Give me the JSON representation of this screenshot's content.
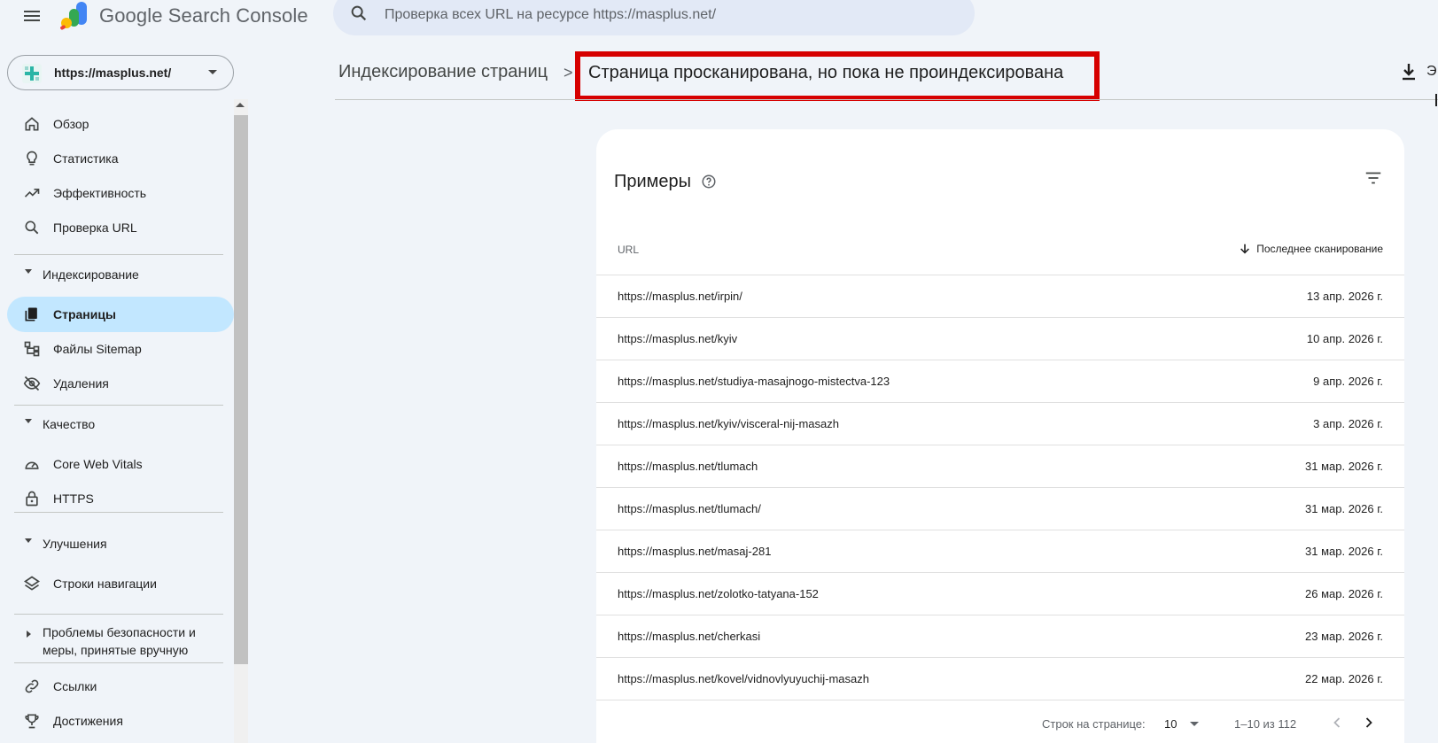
{
  "app": {
    "brand": "Google Search Console",
    "search_placeholder": "Проверка всех URL на ресурсе https://masplus.net/"
  },
  "property": {
    "label": "https://masplus.net/"
  },
  "sidebar": {
    "top_items": [
      {
        "label": "Обзор",
        "icon": "home-icon"
      },
      {
        "label": "Статистика",
        "icon": "lightbulb-icon"
      },
      {
        "label": "Эффективность",
        "icon": "trending-up-icon"
      },
      {
        "label": "Проверка URL",
        "icon": "search-icon"
      }
    ],
    "indexing": {
      "label": "Индексирование",
      "items": [
        {
          "label": "Страницы",
          "icon": "pages-icon",
          "active": true
        },
        {
          "label": "Файлы Sitemap",
          "icon": "sitemap-icon"
        },
        {
          "label": "Удаления",
          "icon": "visibility-off-icon"
        }
      ]
    },
    "quality": {
      "label": "Качество",
      "items": [
        {
          "label": "Core Web Vitals",
          "icon": "speed-icon"
        },
        {
          "label": "HTTPS",
          "icon": "lock-icon"
        }
      ]
    },
    "enhancements": {
      "label": "Улучшения",
      "items": [
        {
          "label": "Строки навигации",
          "icon": "layers-icon"
        }
      ]
    },
    "security": {
      "label_line1": "Проблемы безопасности и",
      "label_line2": "меры, принятые вручную"
    },
    "bottom_items": [
      {
        "label": "Ссылки",
        "icon": "link-icon"
      },
      {
        "label": "Достижения",
        "icon": "trophy-icon"
      }
    ]
  },
  "header": {
    "parent": "Индексирование страниц",
    "separator": ">",
    "current": "Страница просканирована, но пока не проиндексирована",
    "export_label": "Э",
    "highlight_color": "#d60000"
  },
  "card": {
    "title": "Примеры",
    "col_url": "URL",
    "col_date": "Последнее сканирование",
    "rows": [
      {
        "url": "https://masplus.net/irpin/",
        "date": "13 апр. 2026 г."
      },
      {
        "url": "https://masplus.net/kyiv",
        "date": "10 апр. 2026 г."
      },
      {
        "url": "https://masplus.net/studiya-masajnogo-mistectva-123",
        "date": "9 апр. 2026 г."
      },
      {
        "url": "https://masplus.net/kyiv/visceral-nij-masazh",
        "date": "3 апр. 2026 г."
      },
      {
        "url": "https://masplus.net/tlumach",
        "date": "31 мар. 2026 г."
      },
      {
        "url": "https://masplus.net/tlumach/",
        "date": "31 мар. 2026 г."
      },
      {
        "url": "https://masplus.net/masaj-281",
        "date": "31 мар. 2026 г."
      },
      {
        "url": "https://masplus.net/zolotko-tatyana-152",
        "date": "26 мар. 2026 г."
      },
      {
        "url": "https://masplus.net/cherkasi",
        "date": "23 мар. 2026 г."
      },
      {
        "url": "https://masplus.net/kovel/vidnovlyuyuchij-masazh",
        "date": "22 мар. 2026 г."
      }
    ],
    "pager": {
      "rows_per_page_label": "Строк на странице:",
      "rows_per_page": "10",
      "range": "1–10 из 112"
    }
  }
}
